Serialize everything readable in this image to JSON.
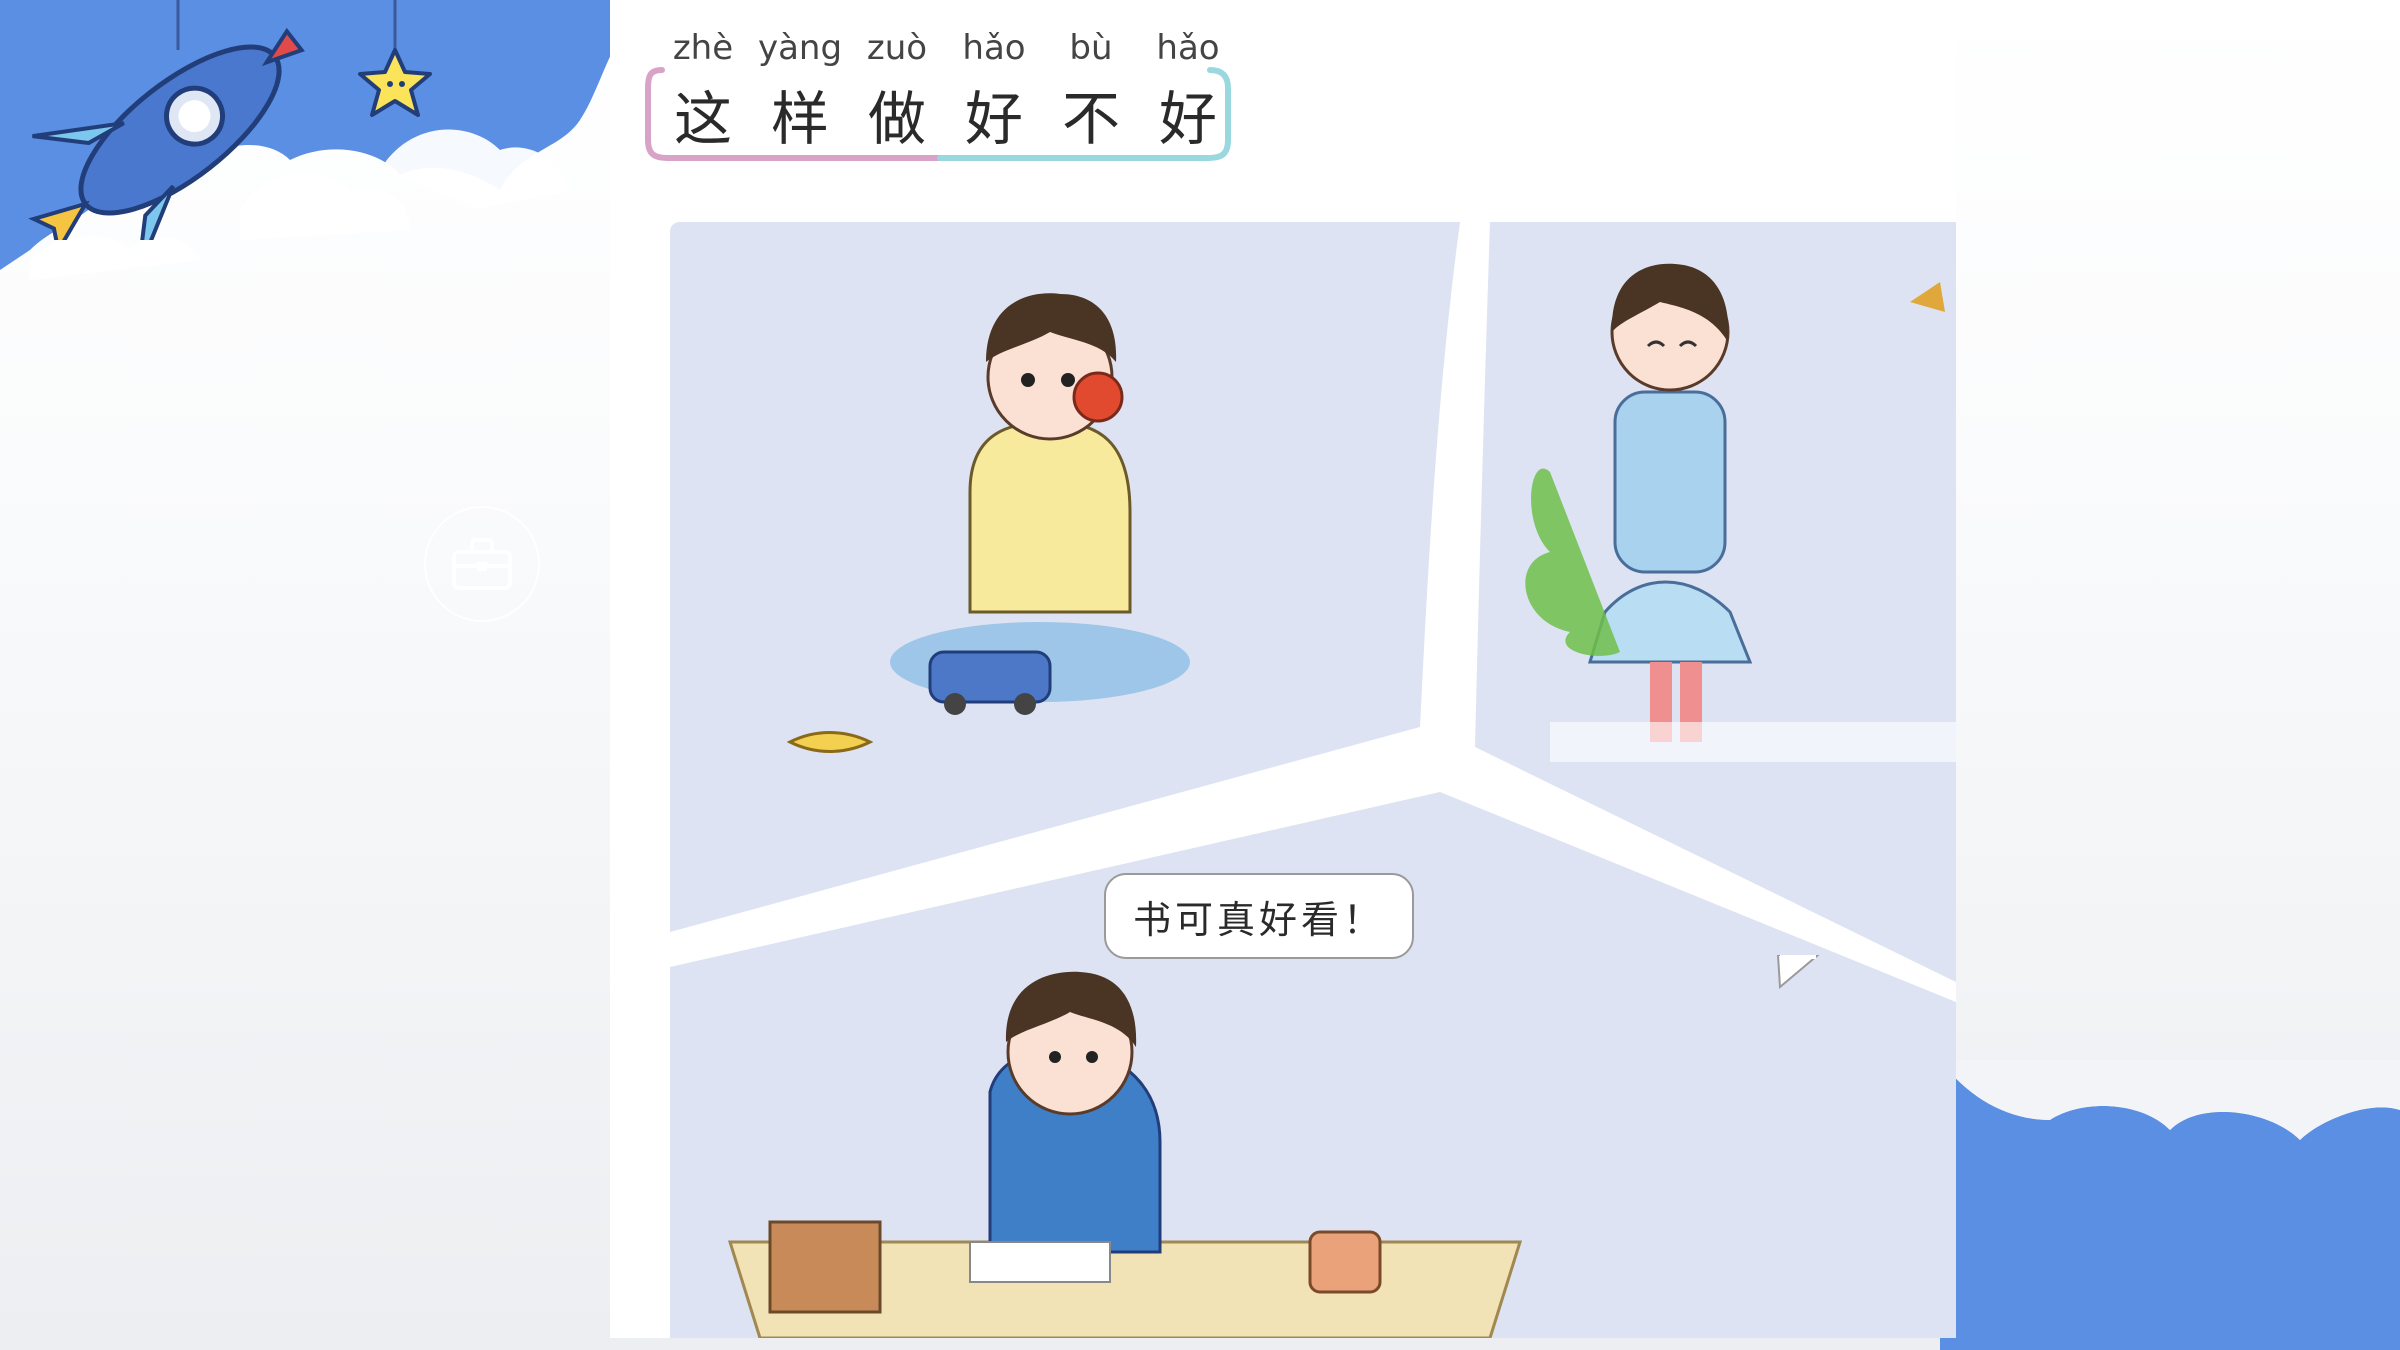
{
  "lesson": {
    "title_syllables": [
      {
        "pinyin": "zhè",
        "hanzi": "这"
      },
      {
        "pinyin": "yàng",
        "hanzi": "样"
      },
      {
        "pinyin": "zuò",
        "hanzi": "做"
      },
      {
        "pinyin": "hǎo",
        "hanzi": "好"
      },
      {
        "pinyin": "bù",
        "hanzi": "不"
      },
      {
        "pinyin": "hǎo",
        "hanzi": "好"
      }
    ]
  },
  "comic": {
    "panels": [
      "boy-eating-apple",
      "girl-with-backpack",
      "boy-reading-at-messy-desk"
    ],
    "speech_bubble": "书可真好看！"
  },
  "decor": {
    "icons": [
      "rocket-icon",
      "star-icon",
      "toolbox-icon"
    ],
    "colors": {
      "brand_blue": "#5b8fe3",
      "panel_bg": "#dde3f3",
      "title_pink": "#d9a3c8",
      "title_teal": "#9ad8df"
    }
  }
}
